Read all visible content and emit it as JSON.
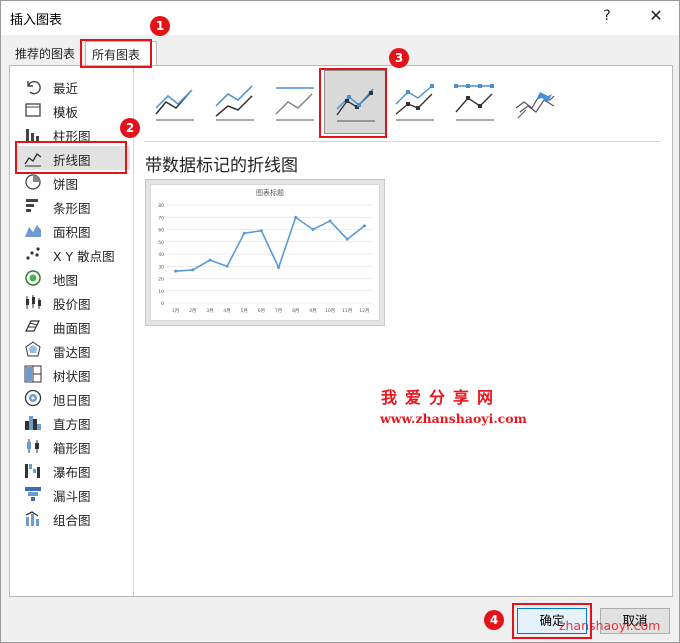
{
  "dialog": {
    "title": "插入图表",
    "help": "?",
    "close": "✕"
  },
  "tabs": [
    {
      "label": "推荐的图表",
      "selected": false
    },
    {
      "label": "所有图表",
      "selected": true
    }
  ],
  "sidebar": {
    "items": [
      {
        "label": "最近",
        "icon": "recent-icon"
      },
      {
        "label": "模板",
        "icon": "folder-icon"
      },
      {
        "label": "柱形图",
        "icon": "column-chart-icon"
      },
      {
        "label": "折线图",
        "icon": "line-chart-icon",
        "selected": true
      },
      {
        "label": "饼图",
        "icon": "pie-chart-icon"
      },
      {
        "label": "条形图",
        "icon": "bar-chart-icon"
      },
      {
        "label": "面积图",
        "icon": "area-chart-icon"
      },
      {
        "label": "X Y 散点图",
        "icon": "scatter-chart-icon"
      },
      {
        "label": "地图",
        "icon": "map-chart-icon"
      },
      {
        "label": "股价图",
        "icon": "stock-chart-icon"
      },
      {
        "label": "曲面图",
        "icon": "surface-chart-icon"
      },
      {
        "label": "雷达图",
        "icon": "radar-chart-icon"
      },
      {
        "label": "树状图",
        "icon": "treemap-chart-icon"
      },
      {
        "label": "旭日图",
        "icon": "sunburst-chart-icon"
      },
      {
        "label": "直方图",
        "icon": "histogram-chart-icon"
      },
      {
        "label": "箱形图",
        "icon": "box-whisker-chart-icon"
      },
      {
        "label": "瀑布图",
        "icon": "waterfall-chart-icon"
      },
      {
        "label": "漏斗图",
        "icon": "funnel-chart-icon"
      },
      {
        "label": "组合图",
        "icon": "combo-chart-icon"
      }
    ]
  },
  "subtypes": [
    {
      "icon": "line-subtype-icon",
      "selected": false
    },
    {
      "icon": "stacked-line-subtype-icon",
      "selected": false
    },
    {
      "icon": "percent-stacked-line-subtype-icon",
      "selected": false
    },
    {
      "icon": "line-with-markers-subtype-icon",
      "selected": true
    },
    {
      "icon": "stacked-line-with-markers-subtype-icon",
      "selected": false
    },
    {
      "icon": "percent-stacked-line-with-markers-subtype-icon",
      "selected": false
    },
    {
      "icon": "3d-line-subtype-icon",
      "selected": false
    }
  ],
  "selected_chart_name": "带数据标记的折线图",
  "preview": {
    "chart_data": {
      "type": "line",
      "title": "图表标题",
      "categories": [
        "1月",
        "2月",
        "3月",
        "4月",
        "5月",
        "6月",
        "7月",
        "8月",
        "9月",
        "10月",
        "11月",
        "12月"
      ],
      "values": [
        26,
        27,
        35,
        30,
        57,
        59,
        29,
        70,
        60,
        67,
        52,
        63
      ],
      "yticks": [
        "0",
        "10",
        "20",
        "30",
        "40",
        "50",
        "60",
        "70",
        "80"
      ],
      "ylim": [
        0,
        80
      ],
      "grid": true,
      "markers": true,
      "color": "#5b9bd5"
    }
  },
  "watermark": {
    "cn": "我爱分享网",
    "url": "www.zhanshaoyi.com",
    "corner": "zhanshaoyi.com"
  },
  "buttons": {
    "ok": "确定",
    "cancel": "取消"
  },
  "annotations": [
    "1",
    "2",
    "3",
    "4"
  ],
  "colors": {
    "accent": "#0078d7",
    "highlight": "#e2141a",
    "series": "#5b9bd5"
  }
}
